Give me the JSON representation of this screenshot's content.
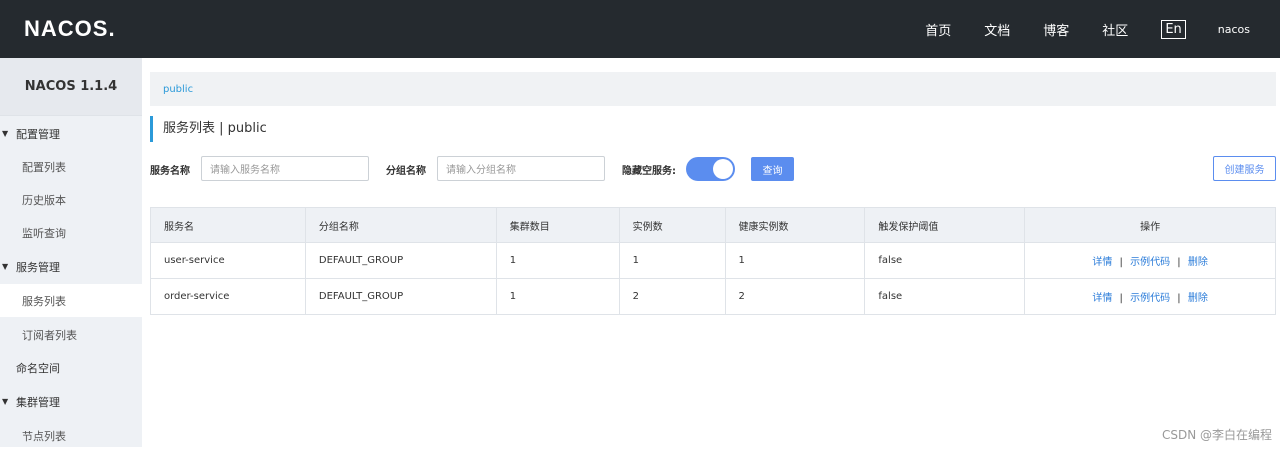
{
  "header": {
    "logo": "NACOS.",
    "nav": [
      "首页",
      "文档",
      "博客",
      "社区"
    ],
    "lang": "En",
    "user": "nacos"
  },
  "sidebar": {
    "title": "NACOS 1.1.4",
    "items": [
      {
        "label": "配置管理",
        "type": "group"
      },
      {
        "label": "配置列表",
        "type": "sub"
      },
      {
        "label": "历史版本",
        "type": "sub"
      },
      {
        "label": "监听查询",
        "type": "sub"
      },
      {
        "label": "服务管理",
        "type": "group"
      },
      {
        "label": "服务列表",
        "type": "sub",
        "active": true
      },
      {
        "label": "订阅者列表",
        "type": "sub"
      },
      {
        "label": "命名空间",
        "type": "plain"
      },
      {
        "label": "集群管理",
        "type": "group"
      },
      {
        "label": "节点列表",
        "type": "sub"
      }
    ]
  },
  "main": {
    "breadcrumb": "public",
    "title": "服务列表 | public",
    "filters": {
      "service_name_label": "服务名称",
      "service_name_placeholder": "请输入服务名称",
      "group_name_label": "分组名称",
      "group_name_placeholder": "请输入分组名称",
      "hide_empty_label": "隐藏空服务:",
      "hide_empty_on": true,
      "query_label": "查询",
      "create_label": "创建服务"
    },
    "table": {
      "headers": [
        "服务名",
        "分组名称",
        "集群数目",
        "实例数",
        "健康实例数",
        "触发保护阈值",
        "操作"
      ],
      "rows": [
        {
          "cells": [
            "user-service",
            "DEFAULT_GROUP",
            "1",
            "1",
            "1",
            "false"
          ],
          "ops": [
            "详情",
            "示例代码",
            "删除"
          ]
        },
        {
          "cells": [
            "order-service",
            "DEFAULT_GROUP",
            "1",
            "2",
            "2",
            "false"
          ],
          "ops": [
            "详情",
            "示例代码",
            "删除"
          ]
        }
      ],
      "op_separator": "|"
    }
  },
  "watermark": "CSDN @李白在编程",
  "colors": {
    "accent": "#5b8def",
    "topbar": "#252a2f",
    "link": "#2b7cd9"
  }
}
